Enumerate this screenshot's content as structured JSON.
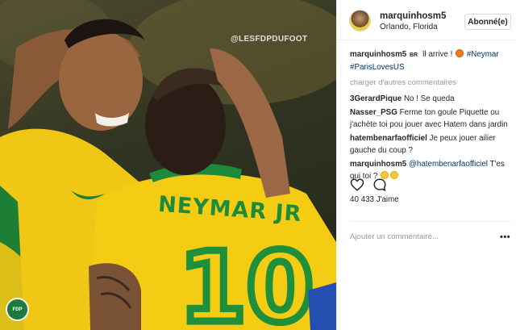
{
  "post": {
    "watermark": "@LESFDPDUFOOT",
    "jersey_text": "NEYMAR JR",
    "jersey_number": "10",
    "logo_text": "FDP"
  },
  "header": {
    "username": "marquinhosm5",
    "location": "Orlando, Florida",
    "follow_label": "Abonné(e)"
  },
  "caption": {
    "username": "marquinhosm5",
    "badge": "BR",
    "text": "Il arrive !",
    "tag1": "#Neymar",
    "tag2": "#ParisLovesUS"
  },
  "load_more": "charger d'autres commentaires",
  "comments": [
    {
      "username": "3GerardPique",
      "text": "No ! Se queda"
    },
    {
      "username": "Nasser_PSG",
      "text": "Ferme ton goule Piquette ou j'achète toi pou jouer avec Hatem dans jardin"
    },
    {
      "username": "hatembenarfaofficiel",
      "text": "Je peux jouer ailier gauche du coup ?"
    },
    {
      "username": "marquinhosm5",
      "mention": "@hatembenarfaofficiel",
      "text": "T'es qui toi ?"
    }
  ],
  "likes": {
    "count": "40 433",
    "label": "J'aime"
  },
  "add_comment_placeholder": "Ajouter un commentaire...",
  "more_label": "•••",
  "icons": {
    "like": "heart-icon",
    "comment": "comment-icon",
    "more": "more-options-icon",
    "fire": "fire-emoji",
    "joy": "joy-emoji"
  }
}
